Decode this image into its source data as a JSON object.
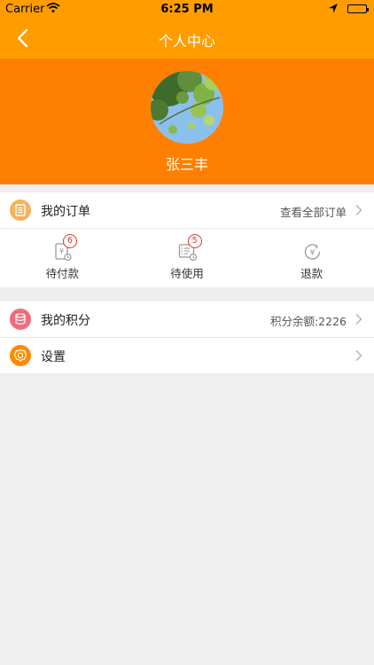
{
  "status_bar": {
    "carrier": "Carrier",
    "time": "6:25 PM"
  },
  "nav": {
    "title": "个人中心"
  },
  "profile": {
    "username": "张三丰"
  },
  "orders_section": {
    "title": "我的订单",
    "view_all": "查看全部订单",
    "items": [
      {
        "label": "待付款",
        "badge": "6",
        "icon": "pending-payment-icon"
      },
      {
        "label": "待使用",
        "badge": "5",
        "icon": "to-use-icon"
      },
      {
        "label": "退款",
        "icon": "refund-icon"
      }
    ]
  },
  "menu": {
    "points_label": "我的积分",
    "points_balance": "积分余额:2226",
    "settings_label": "设置"
  },
  "colors": {
    "nav_orange": "#ff9d00",
    "header_orange": "#ff8000",
    "order_icon": "#f5b15c",
    "points_icon": "#f26b7a",
    "settings_icon": "#ff8a00",
    "badge_red": "#e6322b"
  }
}
